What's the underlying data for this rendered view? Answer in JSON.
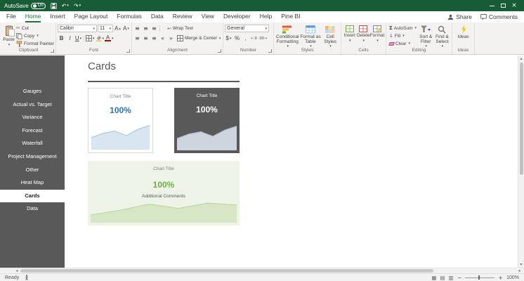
{
  "titlebar": {
    "autosave_label": "AutoSave",
    "autosave_state": "On"
  },
  "menubar": {
    "tabs": [
      "File",
      "Home",
      "Insert",
      "Page Layout",
      "Formulas",
      "Data",
      "Review",
      "View",
      "Developer",
      "Help",
      "Pine BI"
    ],
    "active_tab": "Home",
    "share": "Share",
    "comments": "Comments"
  },
  "ribbon": {
    "clipboard": {
      "group": "Clipboard",
      "paste": "Paste",
      "cut": "Cut",
      "copy": "Copy",
      "format_painter": "Format Painter"
    },
    "font": {
      "group": "Font",
      "family": "Calibri",
      "size": "11",
      "bold": "B",
      "italic": "I",
      "underline": "U",
      "grow": "A",
      "shrink": "A",
      "color_letter": "A"
    },
    "alignment": {
      "group": "Alignment",
      "wrap": "Wrap Text",
      "merge": "Merge & Center"
    },
    "number": {
      "group": "Number",
      "format": "General",
      "currency": "$",
      "percent": "%",
      "comma": ",",
      "increase_decimal": "←.0",
      "decrease_decimal": ".00→"
    },
    "styles": {
      "group": "Styles",
      "conditional_1": "Conditional",
      "conditional_2": "Formatting",
      "format_table_1": "Format as",
      "format_table_2": "Table",
      "cell_styles_1": "Cell",
      "cell_styles_2": "Styles"
    },
    "cells": {
      "group": "Cells",
      "insert": "Insert",
      "delete": "Delete",
      "format": "Format"
    },
    "editing": {
      "group": "Editing",
      "autosum": "AutoSum",
      "fill": "Fill",
      "clear": "Clear",
      "sort_1": "Sort &",
      "sort_2": "Filter",
      "find_1": "Find &",
      "find_2": "Select"
    },
    "ideas": {
      "group": "Ideas",
      "ideas": "Ideas"
    }
  },
  "icons": {
    "caret": "▾",
    "caret_up": "▴",
    "undo": "↶",
    "redo": "↷",
    "close": "×",
    "scissors": "✂",
    "sigma": "Σ",
    "fill_down_arrow": "↓",
    "wrap_text": "↩",
    "align_lines": "≡",
    "indent_decrease": "«",
    "indent_increase": "»",
    "scroll_up": "▴",
    "scroll_down": "▾",
    "scroll_left": "◂",
    "scroll_right": "▸",
    "view_normal": "▦",
    "view_page_layout": "▤",
    "view_page_break": "▥",
    "zoom_out": "−",
    "zoom_in": "+"
  },
  "sidebar": {
    "items": [
      {
        "label": "Gauges",
        "active": false
      },
      {
        "label": "Actual vs. Target",
        "active": false
      },
      {
        "label": "Variance",
        "active": false
      },
      {
        "label": "Forecast",
        "active": false
      },
      {
        "label": "Waterfall",
        "active": false
      },
      {
        "label": "Project Management",
        "active": false
      },
      {
        "label": "Other",
        "active": false
      },
      {
        "label": "Heat Map",
        "active": false
      },
      {
        "label": "Cards",
        "active": true
      },
      {
        "label": "Data",
        "active": false
      }
    ]
  },
  "main": {
    "title": "Cards"
  },
  "chart_data": [
    {
      "type": "area",
      "title": "Chart Title",
      "value_label": "100%",
      "x": [
        0,
        1,
        2,
        3,
        4,
        5
      ],
      "values": [
        42,
        58,
        66,
        50,
        72,
        86
      ],
      "ylim": [
        0,
        100
      ],
      "colors": {
        "card_bg": "#ffffff",
        "border": "#d9d9d9",
        "title": "#7f7f7f",
        "value": "#2e75b6",
        "area_fill": "#d8e6f2",
        "area_line": "#aac7e0"
      }
    },
    {
      "type": "area",
      "title": "Chart Title",
      "value_label": "100%",
      "x": [
        0,
        1,
        2,
        3,
        4,
        5
      ],
      "values": [
        42,
        58,
        66,
        50,
        72,
        86
      ],
      "ylim": [
        0,
        100
      ],
      "colors": {
        "card_bg": "#595959",
        "title": "#ffffff",
        "value": "#ffffff",
        "area_fill": "#cdd5de",
        "area_line": "#b0bcc9"
      }
    },
    {
      "type": "area",
      "title": "Chart Title",
      "value_label": "100%",
      "comment": "Additional Comments",
      "x": [
        0,
        1,
        2,
        3,
        4,
        5
      ],
      "values": [
        32,
        52,
        78,
        60,
        82,
        74
      ],
      "ylim": [
        0,
        100
      ],
      "colors": {
        "card_bg": "#edf3e7",
        "title": "#7f7f7f",
        "value": "#70ad47",
        "comment": "#595959",
        "area_fill": "#d7e7c6",
        "area_line": "#bcd9a2"
      }
    }
  ],
  "statusbar": {
    "status": "Ready",
    "zoom_level": "100%"
  }
}
